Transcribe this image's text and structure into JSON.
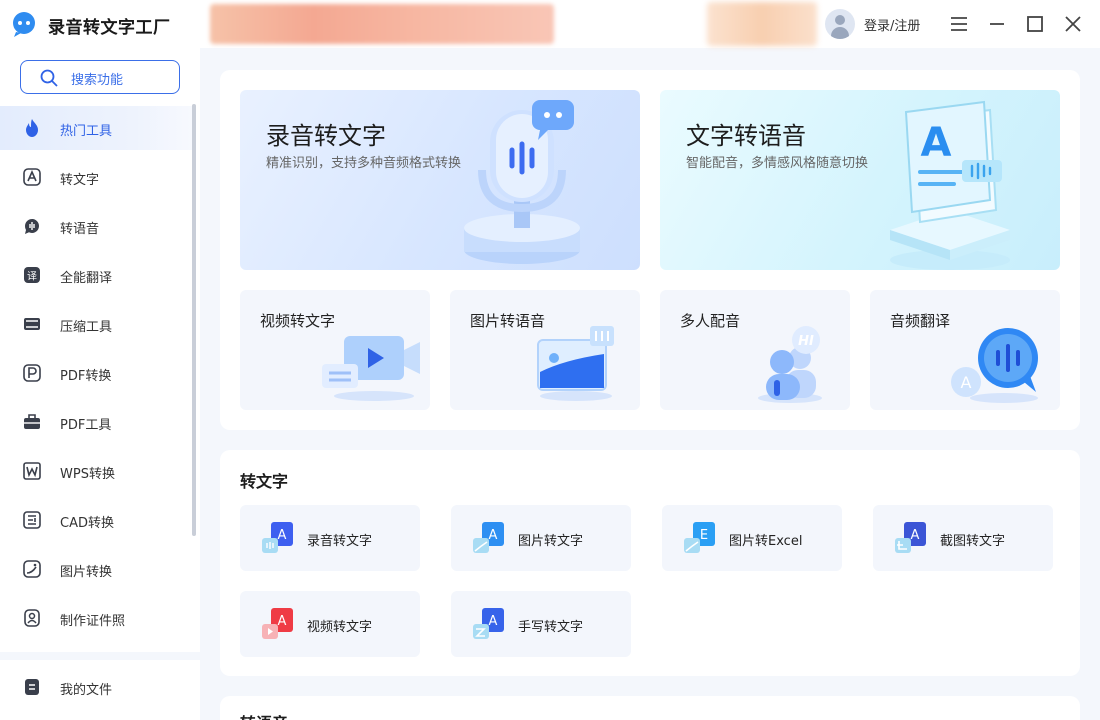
{
  "app": {
    "title": "录音转文字工厂",
    "login_label": "登录/注册"
  },
  "sidebar": {
    "search_label": "搜索功能",
    "items": [
      {
        "label": "热门工具",
        "icon": "flame-icon"
      },
      {
        "label": "转文字",
        "icon": "text-convert-icon"
      },
      {
        "label": "转语音",
        "icon": "voice-icon"
      },
      {
        "label": "全能翻译",
        "icon": "translate-icon"
      },
      {
        "label": "压缩工具",
        "icon": "compress-icon"
      },
      {
        "label": "PDF转换",
        "icon": "pdf-convert-icon"
      },
      {
        "label": "PDF工具",
        "icon": "toolbox-icon"
      },
      {
        "label": "WPS转换",
        "icon": "wps-icon"
      },
      {
        "label": "CAD转换",
        "icon": "cad-icon"
      },
      {
        "label": "图片转换",
        "icon": "image-convert-icon"
      },
      {
        "label": "制作证件照",
        "icon": "id-photo-icon"
      }
    ],
    "my_files": "我的文件"
  },
  "featured": {
    "big": [
      {
        "title": "录音转文字",
        "subtitle": "精准识别，支持多种音频格式转换"
      },
      {
        "title": "文字转语音",
        "subtitle": "智能配音，多情感风格随意切换"
      }
    ],
    "small": [
      {
        "title": "视频转文字"
      },
      {
        "title": "图片转语音"
      },
      {
        "title": "多人配音"
      },
      {
        "title": "音频翻译"
      }
    ]
  },
  "section_text": {
    "title": "转文字",
    "tools": [
      {
        "label": "录音转文字",
        "letter": "A",
        "color": "#3d5ff0"
      },
      {
        "label": "图片转文字",
        "letter": "A",
        "color": "#2d8ff2"
      },
      {
        "label": "图片转Excel",
        "letter": "E",
        "color": "#2a9ff4"
      },
      {
        "label": "截图转文字",
        "letter": "A",
        "color": "#3b55d6"
      },
      {
        "label": "视频转文字",
        "letter": "A",
        "color": "#ef3b45"
      },
      {
        "label": "手写转文字",
        "letter": "A",
        "color": "#3763ea"
      }
    ]
  },
  "section_next": {
    "title": "转语音"
  },
  "colors": {
    "accent": "#2f62e6",
    "panel": "#ffffff",
    "background": "#f4f7fc"
  }
}
